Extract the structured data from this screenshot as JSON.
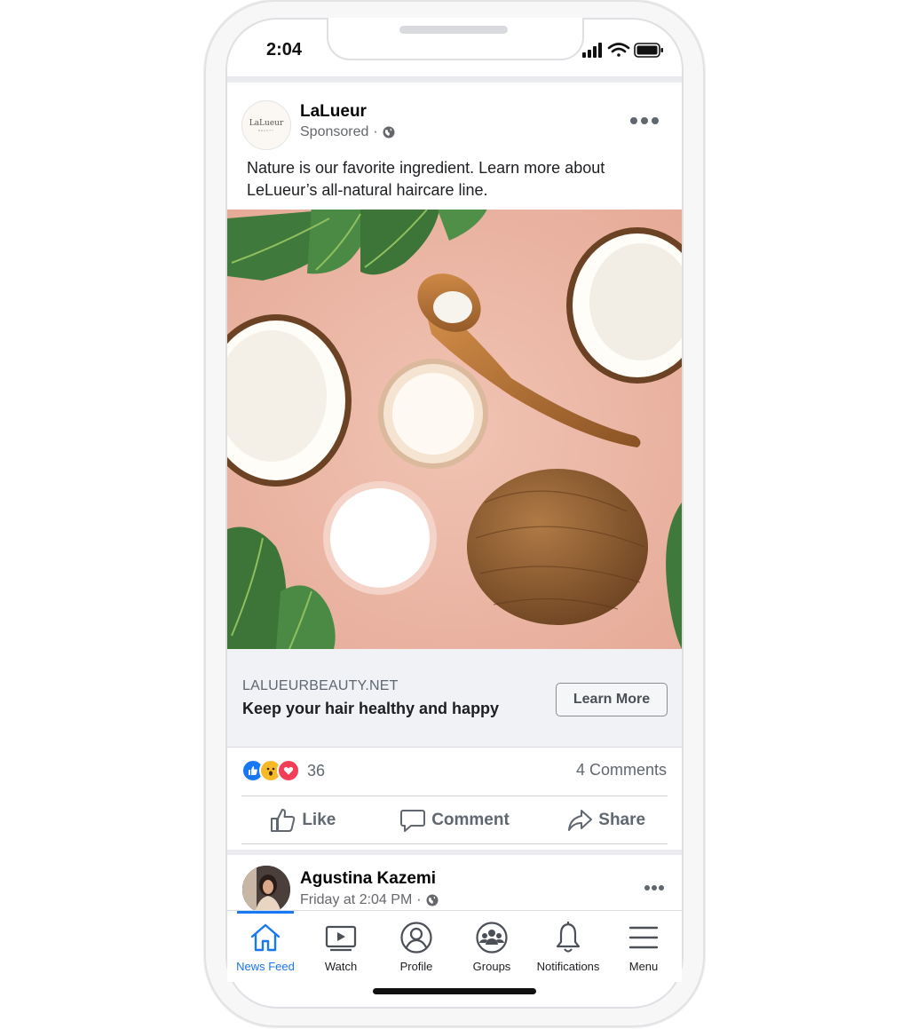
{
  "status_bar": {
    "time": "2:04"
  },
  "ad_post": {
    "page_name": "LaLueur",
    "avatar_logo_text": "LaLueur",
    "avatar_sub_text": "BEAUTY",
    "sponsored_label": "Sponsored",
    "privacy_icon": "globe-icon",
    "caption": "Nature is our favorite ingredient. Learn more about LeLueur’s all-natural haircare line.",
    "link_domain": "LALUEURBEAUTY.NET",
    "link_title": "Keep your hair healthy and happy",
    "cta_label": "Learn More",
    "reaction_icons": [
      "like-reaction-icon",
      "wow-reaction-icon",
      "love-reaction-icon"
    ],
    "reaction_count": "36",
    "comments_count": "4 Comments",
    "actions": [
      {
        "label": "Like",
        "icon": "thumbs-up-icon"
      },
      {
        "label": "Comment",
        "icon": "comment-icon"
      },
      {
        "label": "Share",
        "icon": "share-icon"
      }
    ]
  },
  "next_post": {
    "author": "Agustina Kazemi",
    "timestamp": "Friday at 2:04 PM",
    "privacy_icon": "globe-icon"
  },
  "tab_bar": {
    "active": "News Feed",
    "tabs": [
      {
        "label": "News Feed",
        "icon": "home-icon"
      },
      {
        "label": "Watch",
        "icon": "video-icon"
      },
      {
        "label": "Profile",
        "icon": "profile-icon"
      },
      {
        "label": "Groups",
        "icon": "groups-icon"
      },
      {
        "label": "Notifications",
        "icon": "bell-icon"
      },
      {
        "label": "Menu",
        "icon": "menu-icon"
      }
    ]
  },
  "colors": {
    "accent": "#1877f2",
    "text_secondary": "#606770",
    "feed_background": "#e9ebee",
    "link_bar": "#f0f2f5",
    "media_background": "#eab4a3"
  }
}
